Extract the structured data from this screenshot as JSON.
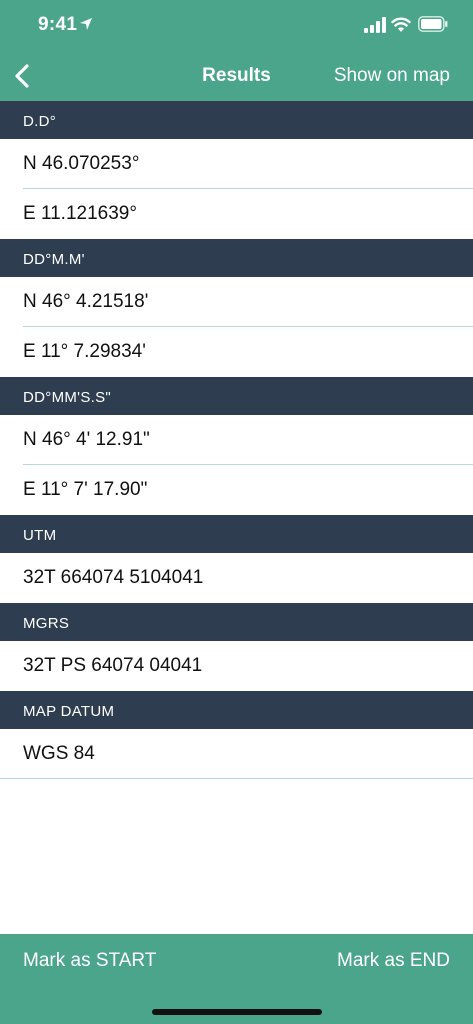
{
  "status_bar": {
    "time": "9:41"
  },
  "nav": {
    "back_icon": "chevron-left-icon",
    "title": "Results",
    "show_on_map": "Show on map"
  },
  "sections": {
    "dd": {
      "header": "D.D°",
      "rows": [
        "N 46.070253°",
        "E 11.121639°"
      ]
    },
    "ddm": {
      "header": "DD°M.M'",
      "rows": [
        "N 46° 4.21518'",
        "E 11° 7.29834'"
      ]
    },
    "dms": {
      "header": "DD°MM'S.S\"",
      "rows": [
        "N 46° 4' 12.91\"",
        "E 11° 7' 17.90\""
      ]
    },
    "utm": {
      "header": "UTM",
      "rows": [
        "32T 664074 5104041"
      ]
    },
    "mgrs": {
      "header": "MGRS",
      "rows": [
        "32T PS 64074 04041"
      ]
    },
    "datum": {
      "header": "MAP DATUM",
      "rows": [
        "WGS 84"
      ]
    }
  },
  "bottom_bar": {
    "mark_start": "Mark as START",
    "mark_end": "Mark as END"
  },
  "colors": {
    "accent": "#4aa58a",
    "section_header": "#2e3d50",
    "separator": "#b7dccf"
  }
}
